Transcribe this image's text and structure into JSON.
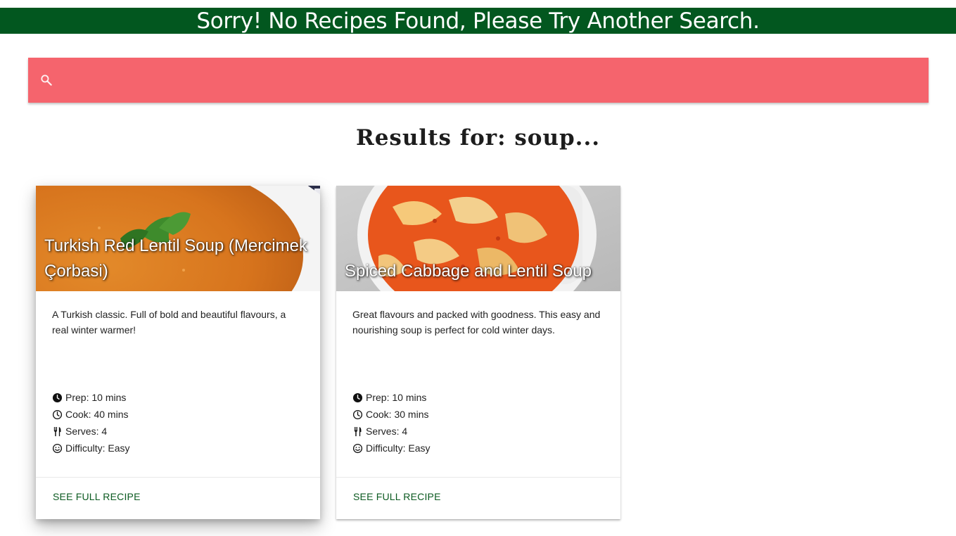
{
  "banner": {
    "message": "Sorry! No Recipes Found, Please Try Another Search."
  },
  "search": {
    "icon": "search-icon",
    "placeholder": "",
    "value": ""
  },
  "results": {
    "heading": "Results for: soup..."
  },
  "cards": [
    {
      "title": "Turkish Red Lentil Soup (Mercimek Çorbasi)",
      "description": "A Turkish classic. Full of bold and beautiful flavours, a real winter warmer!",
      "prep": "Prep: 10 mins",
      "cook": "Cook: 40 mins",
      "serves": "Serves: 4",
      "difficulty": "Difficulty: Easy",
      "action": "SEE FULL RECIPE"
    },
    {
      "title": "Spiced Cabbage and Lentil Soup",
      "description": "Great flavours and packed with goodness. This easy and nourishing soup is perfect for cold winter days.",
      "prep": "Prep: 10 mins",
      "cook": "Cook: 30 mins",
      "serves": "Serves: 4",
      "difficulty": "Difficulty: Easy",
      "action": "SEE FULL RECIPE"
    }
  ],
  "colors": {
    "banner": "#02571f",
    "search_bar": "#f5646d",
    "action_link": "#0b5a20"
  }
}
